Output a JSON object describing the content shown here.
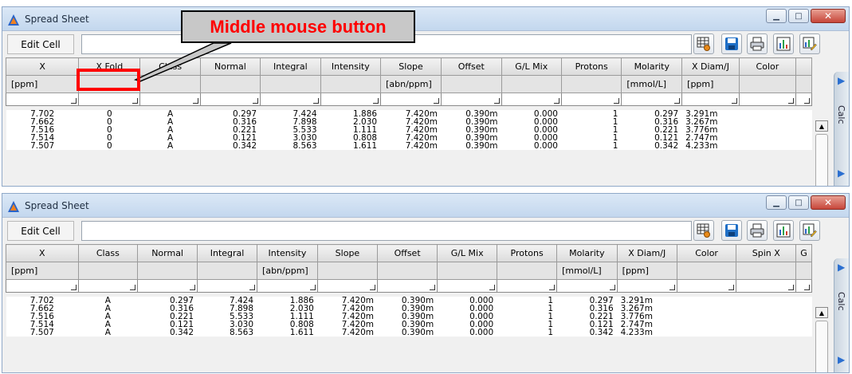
{
  "annotation": {
    "callout_text": "Middle mouse button",
    "highlight_color": "#ff0000"
  },
  "windows": [
    {
      "title": "Spread Sheet",
      "edit_cell_label": "Edit Cell",
      "edit_cell_value": "",
      "columns": [
        "X",
        "X Fold",
        "Class",
        "Normal",
        "Integral",
        "Intensity",
        "Slope",
        "Offset",
        "G/L Mix",
        "Protons",
        "Molarity",
        "X Diam/J",
        "Color",
        ""
      ],
      "units": [
        "[ppm]",
        "",
        "",
        "",
        "",
        "",
        "[abn/ppm]",
        "",
        "",
        "",
        "[mmol/L]",
        "[ppm]",
        "",
        ""
      ],
      "rows": [
        [
          "7.702",
          "0",
          "A",
          "0.297",
          "7.424",
          "1.886",
          "7.420m",
          "0.390m",
          "0.000",
          "1",
          "0.297",
          "3.291m",
          "",
          ""
        ],
        [
          "7.662",
          "0",
          "A",
          "0.316",
          "7.898",
          "2.030",
          "7.420m",
          "0.390m",
          "0.000",
          "1",
          "0.316",
          "3.267m",
          "",
          ""
        ],
        [
          "7.516",
          "0",
          "A",
          "0.221",
          "5.533",
          "1.111",
          "7.420m",
          "0.390m",
          "0.000",
          "1",
          "0.221",
          "3.776m",
          "",
          ""
        ],
        [
          "7.514",
          "0",
          "A",
          "0.121",
          "3.030",
          "0.808",
          "7.420m",
          "0.390m",
          "0.000",
          "1",
          "0.121",
          "2.747m",
          "",
          ""
        ],
        [
          "7.507",
          "0",
          "A",
          "0.342",
          "8.563",
          "1.611",
          "7.420m",
          "0.390m",
          "0.000",
          "1",
          "0.342",
          "4.233m",
          "",
          ""
        ]
      ],
      "side_tab": "Calc"
    },
    {
      "title": "Spread Sheet",
      "edit_cell_label": "Edit Cell",
      "edit_cell_value": "",
      "columns": [
        "X",
        "Class",
        "Normal",
        "Integral",
        "Intensity",
        "Slope",
        "Offset",
        "G/L Mix",
        "Protons",
        "Molarity",
        "X Diam/J",
        "Color",
        "Spin X",
        "G"
      ],
      "units": [
        "[ppm]",
        "",
        "",
        "",
        "[abn/ppm]",
        "",
        "",
        "",
        "",
        "[mmol/L]",
        "[ppm]",
        "",
        "",
        ""
      ],
      "rows": [
        [
          "7.702",
          "A",
          "0.297",
          "7.424",
          "1.886",
          "7.420m",
          "0.390m",
          "0.000",
          "1",
          "0.297",
          "3.291m",
          "",
          "",
          ""
        ],
        [
          "7.662",
          "A",
          "0.316",
          "7.898",
          "2.030",
          "7.420m",
          "0.390m",
          "0.000",
          "1",
          "0.316",
          "3.267m",
          "",
          "",
          ""
        ],
        [
          "7.516",
          "A",
          "0.221",
          "5.533",
          "1.111",
          "7.420m",
          "0.390m",
          "0.000",
          "1",
          "0.221",
          "3.776m",
          "",
          "",
          ""
        ],
        [
          "7.514",
          "A",
          "0.121",
          "3.030",
          "0.808",
          "7.420m",
          "0.390m",
          "0.000",
          "1",
          "0.121",
          "2.747m",
          "",
          "",
          ""
        ],
        [
          "7.507",
          "A",
          "0.342",
          "8.563",
          "1.611",
          "7.420m",
          "0.390m",
          "0.000",
          "1",
          "0.342",
          "4.233m",
          "",
          "",
          ""
        ]
      ],
      "side_tab": "Calc"
    }
  ],
  "toolbar_icons": [
    "grid-settings-icon",
    "save-icon",
    "print-icon",
    "chart-icon",
    "edit-chart-icon"
  ]
}
